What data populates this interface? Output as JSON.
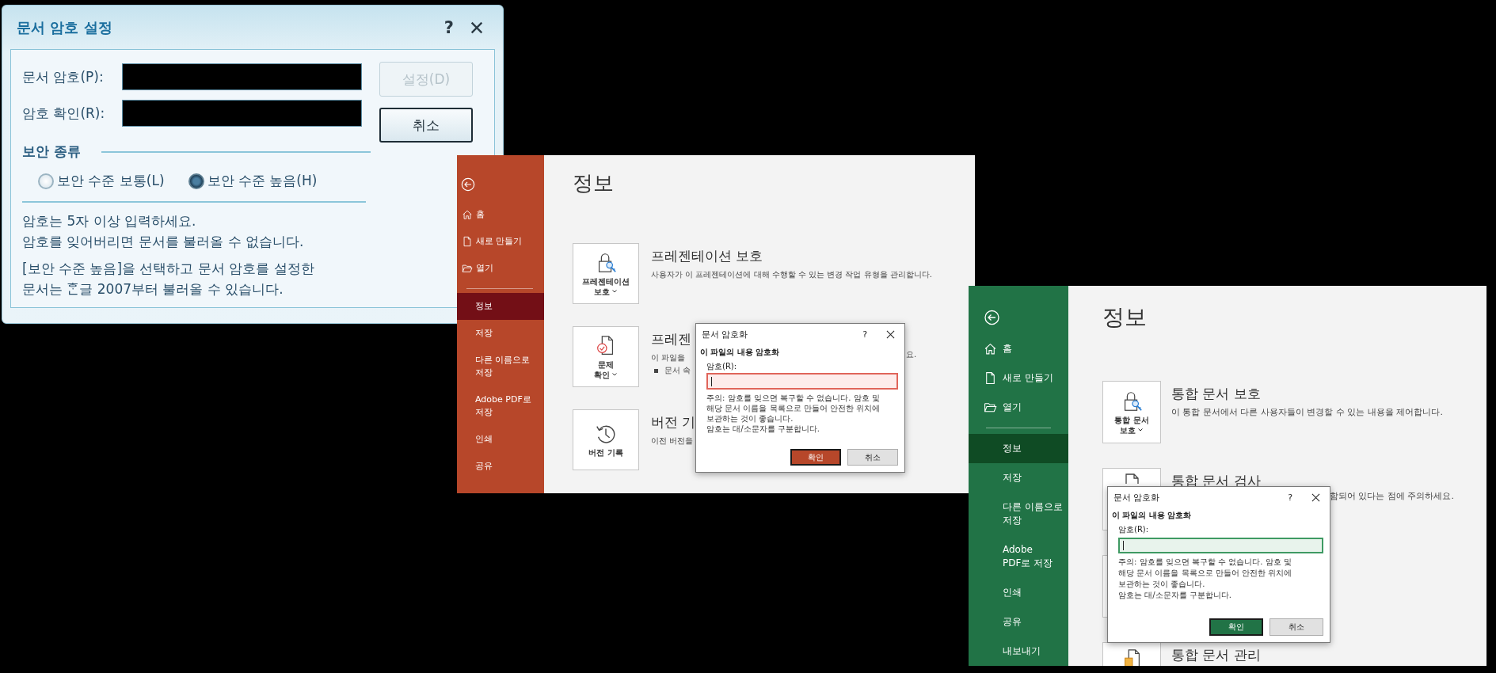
{
  "hangul_dialog": {
    "title": "문서 암호 설정",
    "help": "?",
    "fields": [
      {
        "label": "문서 암호(P):"
      },
      {
        "label": "암호 확인(R):"
      }
    ],
    "buttons": [
      {
        "label": "설정(D)",
        "disabled": true
      },
      {
        "label": "취소",
        "disabled": false
      }
    ],
    "section_title": "보안 종류",
    "radios": [
      {
        "label": "보안 수준 보통(L)",
        "selected": false
      },
      {
        "label": "보안 수준 높음(H)",
        "selected": true
      }
    ],
    "paragraphs": [
      [
        "암호는 5자 이상 입력하세요.",
        "암호를 잊어버리면 문서를 불러올 수 없습니다."
      ],
      [
        "[보안 수준 높음]을 선택하고 문서 암호를 설정한",
        "문서는 ᄒᆞᆫ글 2007부터 불러올 수 있습니다."
      ]
    ]
  },
  "apps": [
    {
      "kind": "powerpoint",
      "sidebar": {
        "groups": [
          [
            {
              "label": "홈",
              "kind": "home",
              "selected": false
            },
            {
              "label": "새로 만들기",
              "kind": "new",
              "selected": false
            },
            {
              "label": "열기",
              "kind": "open",
              "selected": false
            }
          ],
          [
            {
              "label": "정보",
              "selected": true
            },
            {
              "label": "저장",
              "selected": false
            },
            {
              "label": "다른 이름으로 저장",
              "selected": false
            },
            {
              "label": "Adobe PDF로 저장",
              "selected": false
            },
            {
              "label": "인쇄",
              "selected": false
            },
            {
              "label": "공유",
              "selected": false
            }
          ]
        ]
      },
      "heading": "정보",
      "cards": [
        {
          "kind": "lock",
          "button": [
            "프레젠테이션",
            "보호"
          ],
          "dropdown": true,
          "title": "프레젠테이션 보호",
          "description": "사용자가 이 프레젠테이션에 대해 수행할 수 있는 변경 작업 유형을 관리합니다."
        },
        {
          "kind": "check",
          "button": [
            "문제",
            "확인"
          ],
          "dropdown": true,
          "title": "프레젠",
          "description": "이 파일을",
          "bullet": "문서 속",
          "description_tail": "요."
        },
        {
          "kind": "history",
          "button": [
            "버전 기록"
          ],
          "dropdown": false,
          "title": "버전 기",
          "description": "이전 버전을"
        }
      ],
      "dialog": {
        "title": "문서 암호화",
        "help": "?",
        "heading": "이 파일의 내용 암호화",
        "label": "암호(R):",
        "notes": [
          "주의: 암호를 잊으면 복구할 수 없습니다. 암호 및",
          "해당 문서 이름을 목록으로 만들어 안전한 위치에",
          "보관하는 것이 좋습니다.",
          "암호는 대/소문자를 구분합니다."
        ],
        "buttons": [
          {
            "label": "확인",
            "primary": true
          },
          {
            "label": "취소",
            "primary": false
          }
        ]
      }
    },
    {
      "kind": "excel",
      "sidebar": {
        "groups": [
          [
            {
              "label": "홈",
              "kind": "home",
              "selected": false
            },
            {
              "label": "새로 만들기",
              "kind": "new",
              "selected": false
            },
            {
              "label": "열기",
              "kind": "open",
              "selected": false
            }
          ],
          [
            {
              "label": "정보",
              "selected": true
            },
            {
              "label": "저장",
              "selected": false
            },
            {
              "label": "다른 이름으로 저장",
              "selected": false
            },
            {
              "label": "Adobe PDF로 저장",
              "selected": false
            },
            {
              "label": "인쇄",
              "selected": false
            },
            {
              "label": "공유",
              "selected": false
            },
            {
              "label": "내보내기",
              "selected": false
            }
          ]
        ]
      },
      "heading": "정보",
      "cards": [
        {
          "kind": "lock",
          "button": [
            "통합 문서",
            "보호"
          ],
          "dropdown": true,
          "title": "통합 문서 보호",
          "description": "이 통합 문서에서 다른 사용자들이 변경할 수 있는 내용을 제어합니다."
        },
        {
          "kind": "inspect",
          "title": "통합 문서 검사",
          "description_tail": "함되어 있다는 점에 주의하세요."
        },
        {
          "kind": "blank"
        },
        {
          "kind": "manage",
          "title": "통합 문서 관리"
        }
      ],
      "dialog": {
        "title": "문서 암호화",
        "help": "?",
        "heading": "이 파일의 내용 암호화",
        "label": "암호(R):",
        "notes": [
          "주의: 암호를 잊으면 복구할 수 없습니다. 암호 및",
          "해당 문서 이름을 목록으로 만들어 안전한 위치에",
          "보관하는 것이 좋습니다.",
          "암호는 대/소문자를 구분합니다."
        ],
        "buttons": [
          {
            "label": "확인",
            "primary": true
          },
          {
            "label": "취소",
            "primary": false
          }
        ]
      }
    }
  ]
}
